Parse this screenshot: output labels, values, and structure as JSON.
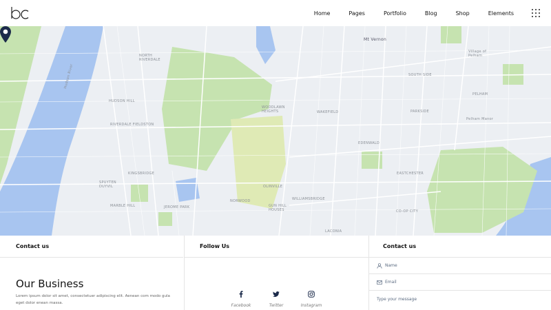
{
  "header": {
    "logo_text": "bc",
    "nav": [
      "Home",
      "Pages",
      "Portfolio",
      "Blog",
      "Shop",
      "Elements"
    ]
  },
  "map": {
    "labels": [
      {
        "text": "Mt Vernon",
        "dark": true
      },
      {
        "text": "NORTH RIVERDALE"
      },
      {
        "text": "HUDSON HILL"
      },
      {
        "text": "RIVERDALE FIELDSTON"
      },
      {
        "text": "KINGSBRIDGE"
      },
      {
        "text": "SPUYTEN DUYVIL"
      },
      {
        "text": "MARBLE HILL"
      },
      {
        "text": "JEROME PARK"
      },
      {
        "text": "NORWOOD"
      },
      {
        "text": "WOODLAWN HEIGHTS"
      },
      {
        "text": "WAKEFIELD"
      },
      {
        "text": "EDENWALD"
      },
      {
        "text": "OLINVILLE"
      },
      {
        "text": "WILLIAMSBRIDGE"
      },
      {
        "text": "GUN HILL HOUSES"
      },
      {
        "text": "LACONIA"
      },
      {
        "text": "EASTCHESTER"
      },
      {
        "text": "CO-OP CITY"
      },
      {
        "text": "SOUTH SIDE"
      },
      {
        "text": "PARKSIDE"
      },
      {
        "text": "PELHAM"
      },
      {
        "text": "Pelham Manor"
      },
      {
        "text": "Village of Pelham"
      },
      {
        "text": "Hudson River"
      }
    ],
    "colors": {
      "water": "#a8c5f0",
      "park": "#c6e3b0",
      "land": "#eceff3",
      "road": "#ffffff",
      "pin": "#1b2a4a"
    }
  },
  "footer": {
    "col1": {
      "heading": "Contact us",
      "title": "Our Business",
      "text": "Lorem ipsum dolor sit amet, consectetuer adipiscing elit. Aenean com modo gula eget dolor enean massa."
    },
    "col2": {
      "heading": "Follow Us",
      "social": [
        {
          "icon": "facebook-icon",
          "label": "Facebook"
        },
        {
          "icon": "twitter-icon",
          "label": "Twitter"
        },
        {
          "icon": "instagram-icon",
          "label": "Instagram"
        }
      ]
    },
    "col3": {
      "heading": "Contact us",
      "name_placeholder": "Name",
      "email_placeholder": "Email",
      "message_placeholder": "Type your message"
    }
  }
}
